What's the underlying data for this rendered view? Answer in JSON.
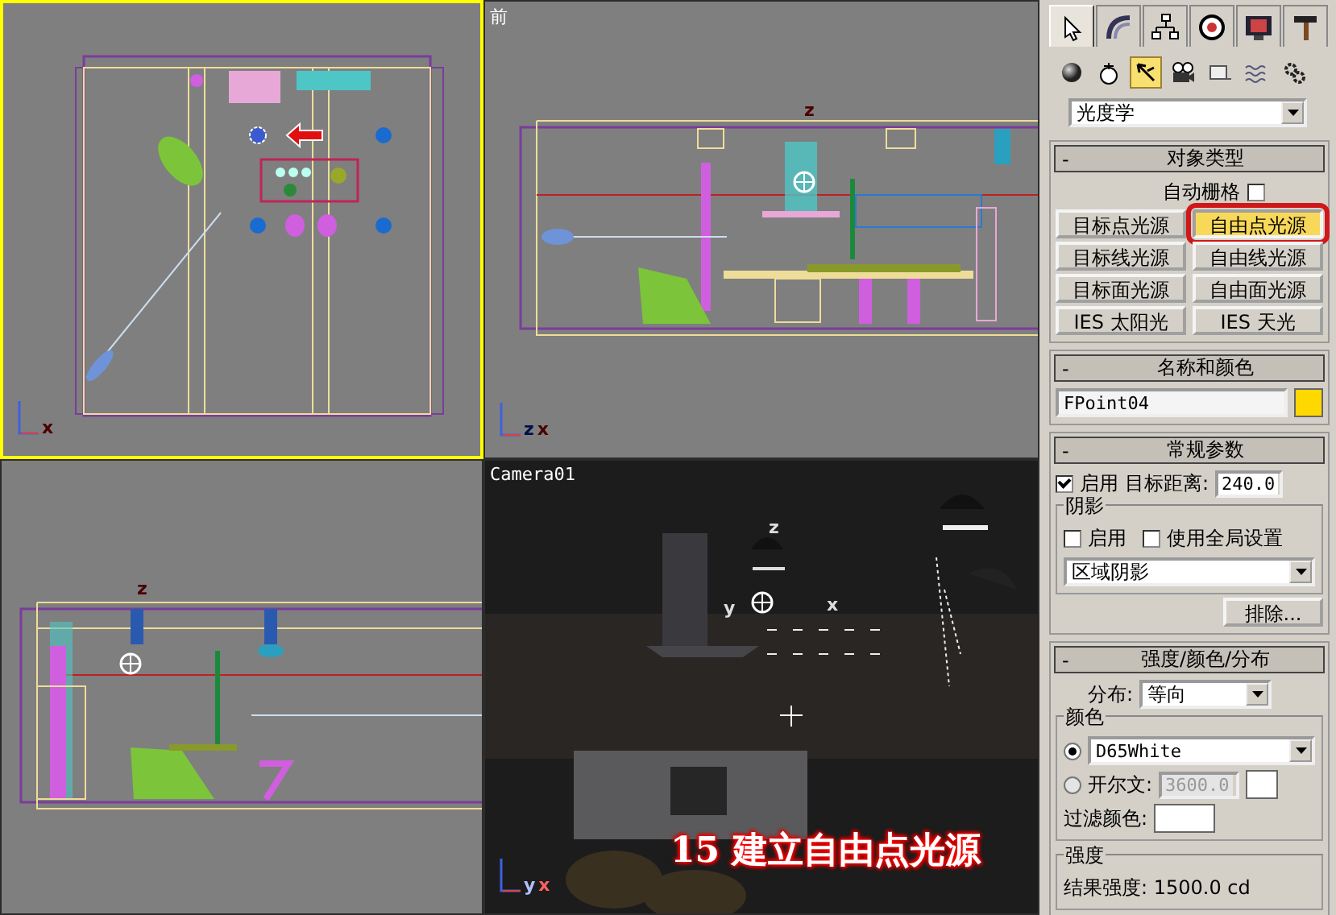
{
  "viewports": [
    {
      "kind": "top",
      "active": true,
      "axis_labels": [
        "x"
      ]
    },
    {
      "kind": "front",
      "label": "前",
      "active": false,
      "axis_labels": [
        "z",
        "x"
      ],
      "gizmo_labels": [
        "z"
      ]
    },
    {
      "kind": "left",
      "active": false,
      "gizmo_labels": [
        "z"
      ]
    },
    {
      "kind": "camera",
      "label": "Camera01",
      "active": false,
      "axis_labels": [
        "y",
        "x"
      ],
      "gizmo_labels": [
        "z",
        "y",
        "x"
      ],
      "caption": "15 建立自由点光源"
    }
  ],
  "command_panel": {
    "tabs": [
      {
        "kind": "create",
        "selected": true
      },
      {
        "kind": "modify",
        "selected": false
      },
      {
        "kind": "hierarchy",
        "selected": false
      },
      {
        "kind": "motion",
        "selected": false
      },
      {
        "kind": "display",
        "selected": false
      },
      {
        "kind": "utilities",
        "selected": false
      }
    ],
    "categories": [
      {
        "kind": "geometry",
        "selected": false
      },
      {
        "kind": "shapes",
        "selected": false
      },
      {
        "kind": "lights",
        "selected": true
      },
      {
        "kind": "cameras",
        "selected": false
      },
      {
        "kind": "helpers",
        "selected": false
      },
      {
        "kind": "spacewarps",
        "selected": false
      },
      {
        "kind": "systems",
        "selected": false
      }
    ],
    "type_dropdown": "光度学",
    "object_type": {
      "title": "对象类型",
      "collapse": "-",
      "auto_grid": {
        "label": "自动栅格",
        "checked": false
      },
      "buttons": [
        {
          "label": "目标点光源",
          "selected": false,
          "highlighted": false
        },
        {
          "label": "自由点光源",
          "selected": true,
          "highlighted": true
        },
        {
          "label": "目标线光源",
          "selected": false,
          "highlighted": false
        },
        {
          "label": "自由线光源",
          "selected": false,
          "highlighted": false
        },
        {
          "label": "目标面光源",
          "selected": false,
          "highlighted": false
        },
        {
          "label": "自由面光源",
          "selected": false,
          "highlighted": false
        },
        {
          "label": "IES 太阳光",
          "selected": false,
          "highlighted": false
        },
        {
          "label": "IES 天光",
          "selected": false,
          "highlighted": false
        }
      ]
    },
    "name_color": {
      "title": "名称和颜色",
      "collapse": "-",
      "name": "FPoint04",
      "color": "#ffd800"
    },
    "general": {
      "title": "常规参数",
      "collapse": "-",
      "enable": {
        "label": "启用",
        "checked": true
      },
      "target_distance_label": "目标距离:",
      "target_distance": "240.0",
      "shadows": {
        "title": "阴影",
        "enable": {
          "label": "启用",
          "checked": false
        },
        "global": {
          "label": "使用全局设置",
          "checked": false
        },
        "type": "区域阴影",
        "exclude": "排除..."
      }
    },
    "intensity_color": {
      "title": "强度/颜色/分布",
      "collapse": "-",
      "distribution_label": "分布:",
      "distribution": "等向",
      "color_group": {
        "title": "颜色",
        "preset": {
          "value": "D65White",
          "selected": true
        },
        "kelvin": {
          "label": "开尔文:",
          "value": "3600.0",
          "selected": false,
          "disabled": true
        },
        "filter_label": "过滤颜色:"
      },
      "intensity_group": {
        "title": "强度",
        "result": "结果强度: 1500.0 cd"
      }
    }
  }
}
